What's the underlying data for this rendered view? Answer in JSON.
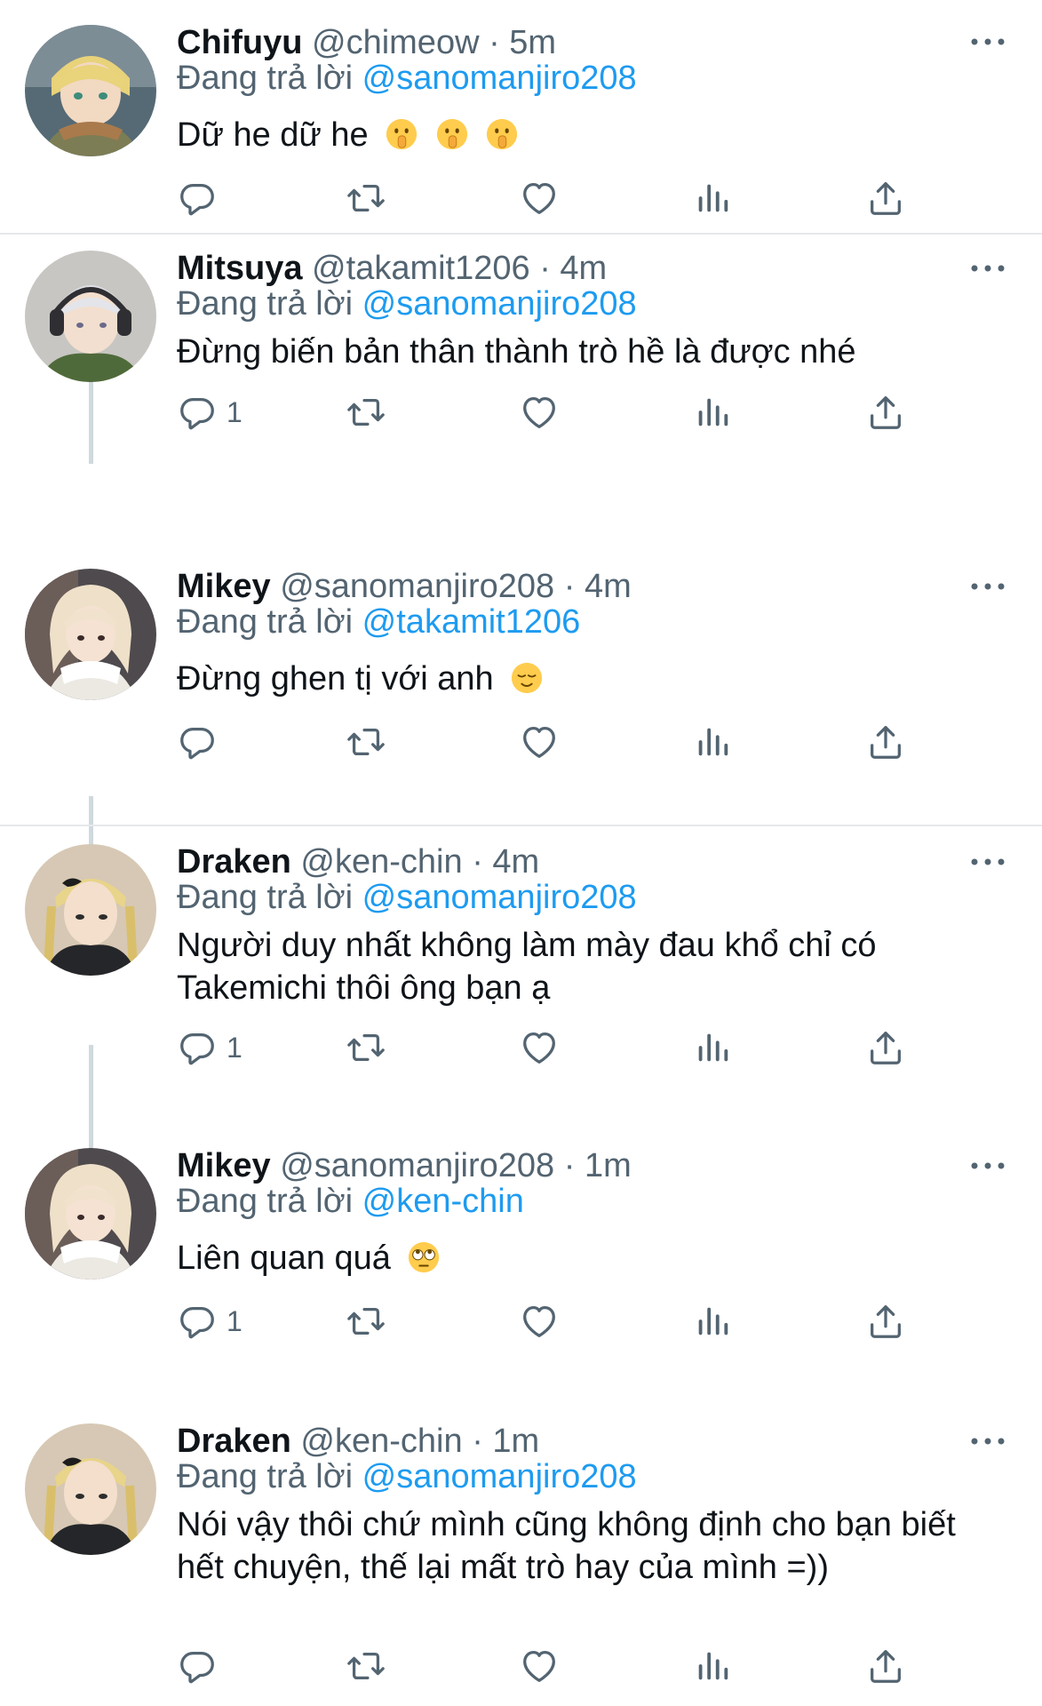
{
  "tweets": [
    {
      "name": "Chifuyu",
      "handle": "@chimeow",
      "dot": "·",
      "time": "5m",
      "reply_prefix": "Đang trả lời",
      "reply_to": "@sanomanjiro208",
      "text": "Dữ he dữ he",
      "emoji": [
        "shushing-face",
        "shushing-face",
        "shushing-face"
      ],
      "reply_count": "",
      "avatar_icon": "avatar-blonde-green-eyes"
    },
    {
      "name": "Mitsuya",
      "handle": "@takamit1206",
      "dot": "·",
      "time": "4m",
      "reply_prefix": "Đang trả lời",
      "reply_to": "@sanomanjiro208",
      "text": "Đừng biến bản thân thành trò hề là được nhé",
      "emoji": [],
      "reply_count": "1",
      "avatar_icon": "avatar-silver-hair-headphones"
    },
    {
      "name": "Mikey",
      "handle": "@sanomanjiro208",
      "dot": "·",
      "time": "4m",
      "reply_prefix": "Đang trả lời",
      "reply_to": "@takamit1206",
      "text": "Đừng ghen tị với anh",
      "emoji": [
        "relieved-face"
      ],
      "reply_count": "",
      "avatar_icon": "avatar-blonde-white-scarf"
    },
    {
      "name": "Draken",
      "handle": "@ken-chin",
      "dot": "·",
      "time": "4m",
      "reply_prefix": "Đang trả lời",
      "reply_to": "@sanomanjiro208",
      "text": "Người duy nhất không làm mày đau khổ chỉ có Takemichi thôi ông bạn ạ",
      "emoji": [],
      "reply_count": "1",
      "avatar_icon": "avatar-braid-tattoo"
    },
    {
      "name": "Mikey",
      "handle": "@sanomanjiro208",
      "dot": "·",
      "time": "1m",
      "reply_prefix": "Đang trả lời",
      "reply_to": "@ken-chin",
      "text": "Liên quan quá",
      "emoji": [
        "face-with-rolling-eyes"
      ],
      "reply_count": "1",
      "avatar_icon": "avatar-blonde-white-scarf"
    },
    {
      "name": "Draken",
      "handle": "@ken-chin",
      "dot": "·",
      "time": "1m",
      "reply_prefix": "Đang trả lời",
      "reply_to": "@sanomanjiro208",
      "text": "Nói vậy thôi chứ mình cũng không định cho bạn biết hết chuyện, thế lại mất trò hay của mình =))",
      "emoji": [],
      "reply_count": "",
      "avatar_icon": "avatar-braid-tattoo"
    }
  ],
  "colors": {
    "link": "#1d9bf0",
    "secondary": "#536471",
    "text": "#0f1419",
    "divider": "#e6e9eb",
    "thread_line": "#cfd9de"
  }
}
